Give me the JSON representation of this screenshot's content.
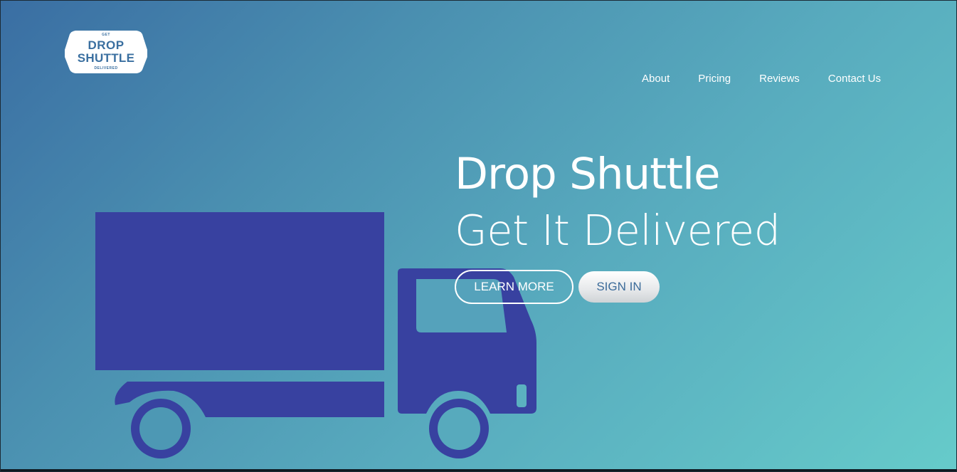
{
  "brand": {
    "logo_top": "GET",
    "logo_line1": "DROP",
    "logo_line2": "SHUTTLE",
    "logo_bottom": "DELIVERED"
  },
  "nav": {
    "items": [
      {
        "label": "About"
      },
      {
        "label": "Pricing"
      },
      {
        "label": "Reviews"
      },
      {
        "label": "Contact Us"
      }
    ]
  },
  "hero": {
    "title": "Drop Shuttle",
    "subtitle": "Get It Delivered",
    "learn_more_label": "LEARN MORE",
    "sign_in_label": "SIGN IN",
    "illustration": "delivery-truck-icon"
  },
  "colors": {
    "gradient_start": "#3a6ea3",
    "gradient_end": "#66cbca",
    "truck": "#3841a0",
    "logo_text": "#3a6fa0",
    "sign_in_text": "#3d6c9a"
  }
}
